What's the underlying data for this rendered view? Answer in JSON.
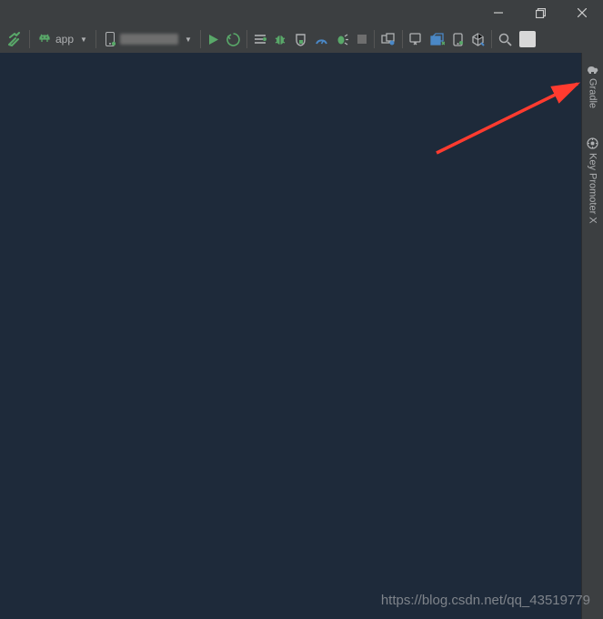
{
  "titlebar": {
    "minimize": "minimize",
    "maximize": "maximize",
    "close": "close"
  },
  "toolbar": {
    "build": "build",
    "config_label": "app",
    "device_label": "device",
    "run": "run",
    "apply": "apply-changes",
    "debug": "debug",
    "coverage": "coverage",
    "profile": "profile",
    "attach": "attach",
    "stop": "stop",
    "sync": "sync",
    "avd": "avd",
    "sdk": "sdk",
    "layout": "layout-inspector",
    "resource": "resource-manager",
    "search": "search",
    "user": "user"
  },
  "right_tools": [
    {
      "icon": "elephant",
      "label": "Gradle"
    },
    {
      "icon": "key",
      "label": "Key Promoter X"
    }
  ],
  "watermark": "https://blog.csdn.net/qq_43519779"
}
